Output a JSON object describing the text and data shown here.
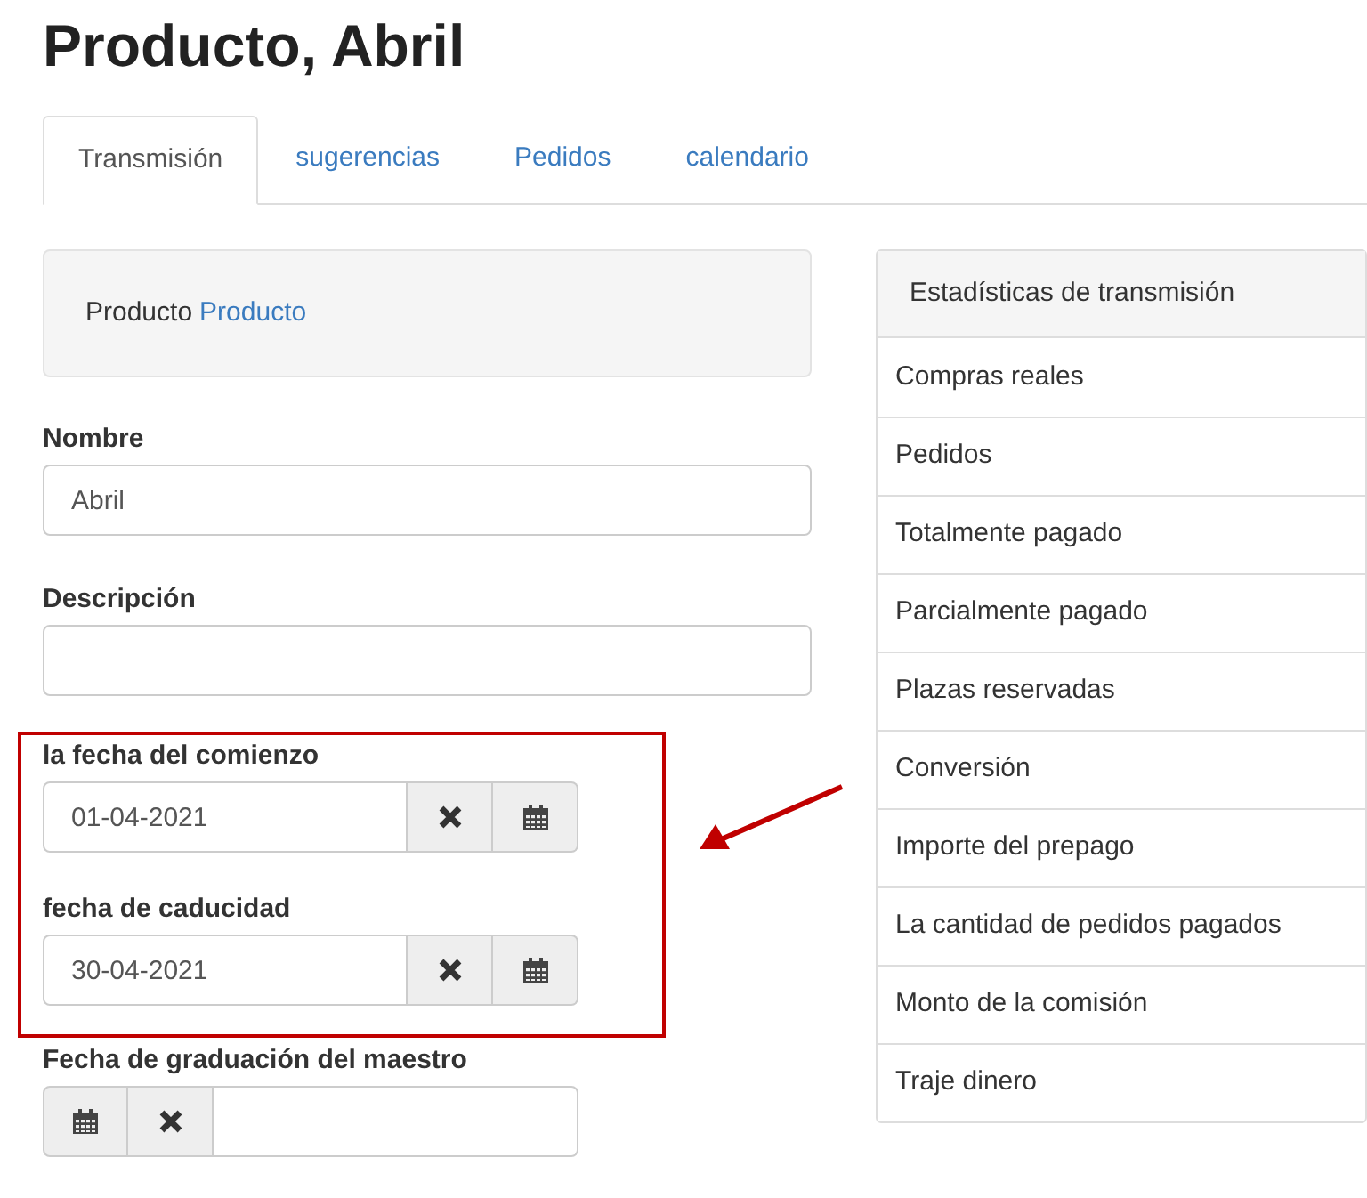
{
  "title": "Producto, Abril",
  "tabs": [
    {
      "label": "Transmisión",
      "selected": true
    },
    {
      "label": "sugerencias",
      "selected": false
    },
    {
      "label": "Pedidos",
      "selected": false
    },
    {
      "label": "calendario",
      "selected": false
    }
  ],
  "product_box": {
    "label": "Producto",
    "link": "Producto"
  },
  "fields": [
    {
      "kind": "text",
      "label": "Nombre",
      "value": "Abril"
    },
    {
      "kind": "text",
      "label": "Descripción"
    },
    {
      "kind": "date",
      "label": "la fecha del comienzo",
      "value": "01-04-2021"
    },
    {
      "kind": "date",
      "label": "fecha de caducidad",
      "value": "30-04-2021"
    },
    {
      "kind": "date_buttons_first",
      "label": "Fecha de graduación del maestro"
    }
  ],
  "stats": {
    "title": "Estadísticas de transmisión",
    "rows": [
      "Compras reales",
      "Pedidos",
      "Totalmente pagado",
      "Parcialmente pagado",
      "Plazas reservadas",
      "Conversión",
      "Importe del prepago",
      "La cantidad de pedidos pagados",
      "Monto de la comisión",
      "Traje dinero"
    ]
  }
}
